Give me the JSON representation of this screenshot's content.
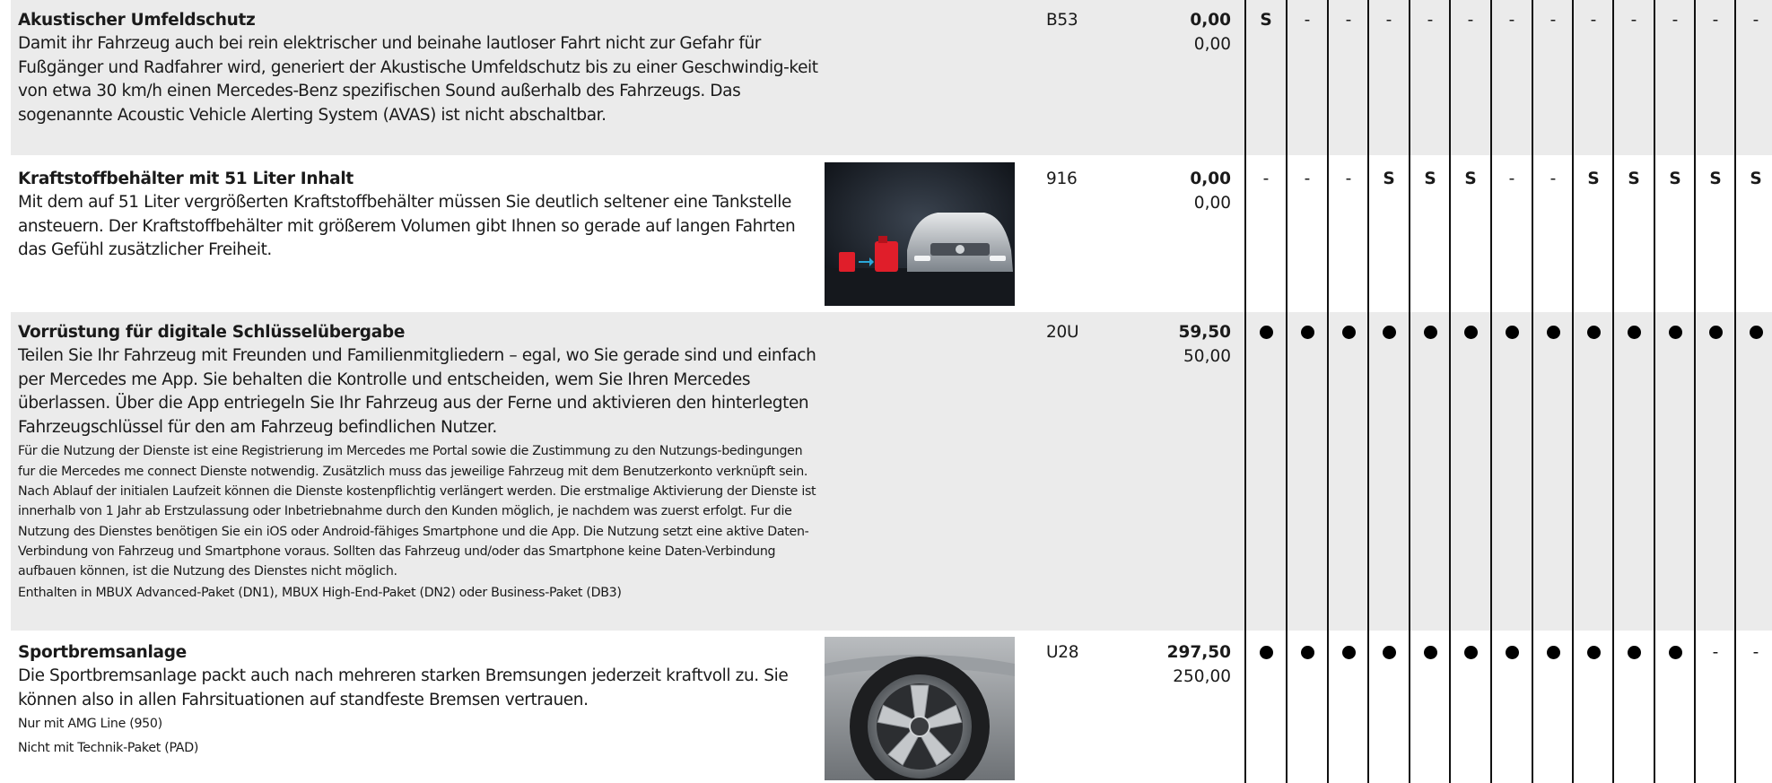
{
  "items": [
    {
      "title": "Akustischer Umfeldschutz",
      "body": "Damit ihr Fahrzeug auch bei rein elektrischer und beinahe lautloser Fahrt nicht zur Gefahr für Fußgänger und Radfahrer wird, generiert der Akustische Umfeldschutz bis zu einer Geschwindig-keit von etwa 30 km/h einen Mercedes-Benz spezifischen Sound außerhalb des Fahrzeugs. Das sogenannte Acoustic Vehicle Alerting System (AVAS) ist nicht abschaltbar.",
      "code": "B53",
      "price_gross": "0,00",
      "price_net": "0,00",
      "marks": [
        "S",
        "-",
        "-",
        "-",
        "-",
        "-",
        "-",
        "-",
        "-",
        "-",
        "-",
        "-",
        "-"
      ]
    },
    {
      "title": "Kraftstoffbehälter mit 51 Liter Inhalt",
      "body": "Mit dem auf 51 Liter vergrößerten Kraftstoffbehälter müssen Sie deutlich seltener eine Tankstelle ansteuern. Der Kraftstoffbehälter mit größerem Volumen gibt Ihnen so gerade auf langen Fahrten das Gefühl zusätzlicher Freiheit.",
      "code": "916",
      "price_gross": "0,00",
      "price_net": "0,00",
      "marks": [
        "-",
        "-",
        "-",
        "S",
        "S",
        "S",
        "-",
        "-",
        "S",
        "S",
        "S",
        "S",
        "S"
      ]
    },
    {
      "title": "Vorrüstung für digitale Schlüsselübergabe",
      "body": "Teilen Sie Ihr Fahrzeug mit Freunden und Familienmitgliedern – egal, wo Sie gerade sind und einfach per Mercedes me App. Sie behalten die Kontrolle und entscheiden, wem Sie Ihren Mercedes überlassen. Über die App entriegeln Sie Ihr Fahrzeug aus der Ferne und aktivieren den hinterlegten Fahrzeugschlüssel für den am Fahrzeug befindlichen Nutzer.",
      "small": "Für die Nutzung der Dienste ist eine Registrierung im Mercedes me Portal sowie die Zustimmung zu den Nutzungs-bedingungen fur die Mercedes me connect Dienste notwendig. Zusätzlich muss das jeweilige Fahrzeug mit dem Benutzerkonto verknüpft sein. Nach Ablauf der initialen Laufzeit können die Dienste kostenpflichtig verlängert werden. Die erstmalige Aktivierung der Dienste ist innerhalb von 1 Jahr ab Erstzulassung oder Inbetriebnahme durch den Kunden möglich, je nachdem was zuerst erfolgt. Fur die Nutzung des Dienstes benötigen Sie ein iOS oder Android-fähiges Smartphone und die App. Die Nutzung setzt eine aktive Daten-Verbindung von Fahrzeug und Smartphone voraus. Sollten das Fahrzeug und/oder das Smartphone keine Daten-Verbindung aufbauen können, ist die Nutzung des Dienstes nicht möglich.",
      "note": "Enthalten in MBUX Advanced-Paket (DN1), MBUX High-End-Paket (DN2) oder Business-Paket (DB3)",
      "code": "20U",
      "price_gross": "59,50",
      "price_net": "50,00",
      "marks": [
        "●",
        "●",
        "●",
        "●",
        "●",
        "●",
        "●",
        "●",
        "●",
        "●",
        "●",
        "●",
        "●"
      ]
    },
    {
      "title": "Sportbremsanlage",
      "body": "Die Sportbremsanlage packt auch nach mehreren starken Bremsungen jederzeit kraftvoll zu. Sie können also in allen Fahrsituationen auf standfeste Bremsen vertrauen.",
      "notes": [
        "Nur mit AMG Line (950)",
        "Nicht mit Technik-Paket (PAD)"
      ],
      "code": "U28",
      "price_gross": "297,50",
      "price_net": "250,00",
      "marks": [
        "●",
        "●",
        "●",
        "●",
        "●",
        "●",
        "●",
        "●",
        "●",
        "●",
        "●",
        "-",
        "-"
      ]
    }
  ],
  "colors": {
    "shade": "#ebebeb",
    "rule": "#111111",
    "fuel_can": "#e01e2a",
    "arrow": "#2aa7d8"
  },
  "icons": {
    "standard_mark": "S",
    "not_available": "-",
    "optional": "filled-circle"
  }
}
